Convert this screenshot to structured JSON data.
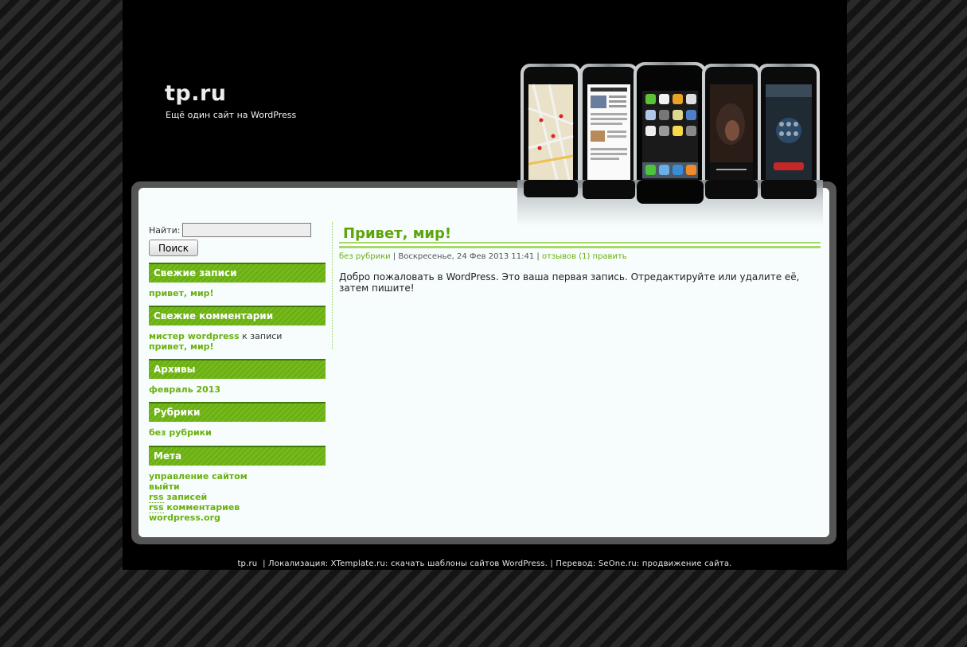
{
  "header": {
    "site_title": "tp.ru",
    "tagline": "Ещё один сайт на WordPress"
  },
  "search": {
    "label": "Найти:",
    "value": "",
    "button": "Поиск"
  },
  "sidebar": {
    "recent_posts": {
      "title": "Свежие записи",
      "items": [
        "привет, мир!"
      ]
    },
    "recent_comments": {
      "title": "Свежие комментарии",
      "author": "мистер wordpress",
      "connector": "к записи",
      "post": "привет, мир!"
    },
    "archives": {
      "title": "Архивы",
      "items": [
        "февраль 2013"
      ]
    },
    "categories": {
      "title": "Рубрики",
      "items": [
        "без рубрики"
      ]
    },
    "meta": {
      "title": "Мета",
      "admin": "управление сайтом",
      "logout": "выйти",
      "rss_abbr": "rss",
      "rss_posts": "записей",
      "rss_comments": "комментариев",
      "wordpress_org": "wordpress.org"
    }
  },
  "post": {
    "title": "Привет, мир!",
    "category": "без рубрики",
    "separator": "|",
    "date": "Воскресенье, 24 Фев 2013 11:41",
    "comments": "отзывов (1)",
    "edit": "править",
    "body": "Добро пожаловать в WordPress. Это ваша первая запись. Отредактируйте или удалите её, затем пишите!"
  },
  "footer": {
    "site": "tp.ru",
    "localization": "| Локализация: XTemplate.ru: скачать шаблоны сайтов  WordPress. | Перевод: SeOne.ru: продвижение сайта."
  },
  "colors": {
    "accent": "#6ab10f",
    "title_green": "#5ea40b",
    "page_bg": "#000000",
    "content_bg": "#f7fcfc"
  },
  "icons": {
    "header_art": "iphone-lineup-image"
  }
}
